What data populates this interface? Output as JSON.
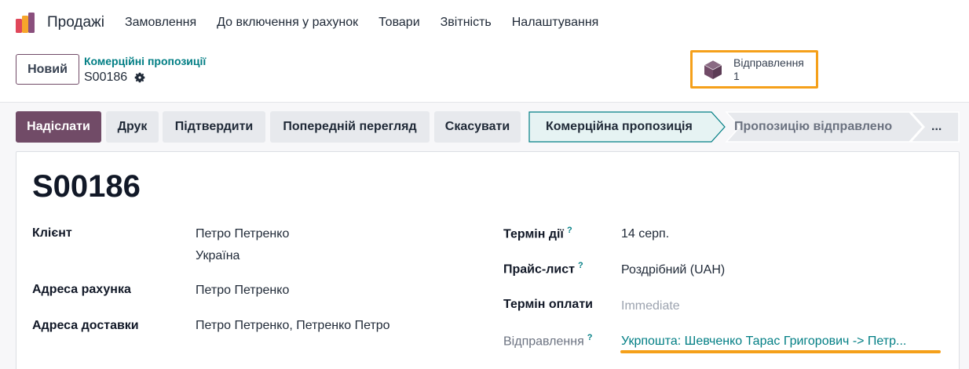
{
  "navbar": {
    "app_name": "Продажі",
    "items": [
      {
        "label": "Замовлення"
      },
      {
        "label": "До включення у рахунок"
      },
      {
        "label": "Товари"
      },
      {
        "label": "Звітність"
      },
      {
        "label": "Налаштування"
      }
    ]
  },
  "control": {
    "new_label": "Новий",
    "breadcrumb": "Комерційні пропозиції",
    "record_name": "S00186",
    "smart_button": {
      "label": "Відправлення",
      "count": "1",
      "icon": "box-icon",
      "highlight_color": "#f5a01a"
    }
  },
  "status_bar": {
    "buttons": [
      {
        "label": "Надіслати"
      },
      {
        "label": "Друк"
      },
      {
        "label": "Підтвердити"
      },
      {
        "label": "Попередній перегляд"
      },
      {
        "label": "Скасувати"
      }
    ],
    "stages": [
      {
        "label": "Комерційна пропозиція",
        "active": true
      },
      {
        "label": "Пропозицію відправлено",
        "active": false
      },
      {
        "label": "...",
        "active": false
      }
    ]
  },
  "form": {
    "title": "S00186",
    "client_label": "Клієнт",
    "client_name": "Петро Петренко",
    "client_country": "Україна",
    "invoice_address_label": "Адреса рахунка",
    "invoice_address_value": "Петро Петренко",
    "delivery_address_label": "Адреса доставки",
    "delivery_address_value": "Петро Петренко, Петренко Петро",
    "validity_label": "Термін дії",
    "validity_value": "14 серп.",
    "pricelist_label": "Прайс-лист",
    "pricelist_value": "Роздрібний (UAH)",
    "payment_terms_label": "Термін оплати",
    "payment_terms_value": "Immediate",
    "shipping_label": "Відправлення",
    "shipping_value": "Укрпошта: Шевченко Тарас Григорович -> Петр...",
    "help_mark": "?"
  },
  "colors": {
    "brand": "#714b67",
    "link": "#017e84",
    "highlight": "#f5a01a"
  }
}
